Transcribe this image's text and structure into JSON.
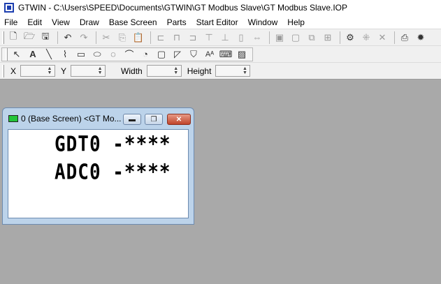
{
  "window": {
    "title": "GTWIN - C:\\Users\\SPEED\\Documents\\GTWIN\\GT Modbus Slave\\GT Modbus Slave.IOP"
  },
  "menu": {
    "items": [
      "File",
      "Edit",
      "View",
      "Draw",
      "Base Screen",
      "Parts",
      "Start Editor",
      "Window",
      "Help"
    ]
  },
  "standard_toolbar": {
    "buttons": [
      "new-icon",
      "open-icon",
      "save-icon",
      "undo-icon",
      "redo-icon",
      "cut-icon",
      "copy-icon",
      "paste-icon",
      "align-left-icon",
      "align-center-icon",
      "align-right-icon",
      "align-top-icon",
      "align-middle-icon",
      "align-bottom-icon",
      "distribute-h-icon",
      "distribute-v-icon",
      "front-icon",
      "back-icon",
      "group-icon",
      "ungroup-icon",
      "lock-icon",
      "properties-icon",
      "grid-icon",
      "snap-icon",
      "transfer-icon",
      "settings-icon"
    ]
  },
  "draw_toolbar": {
    "tools": [
      "select-arrow-icon",
      "text-icon",
      "line-icon",
      "polyline-icon",
      "rectangle-icon",
      "ellipse-icon",
      "arc-icon",
      "sector-icon",
      "pie-icon",
      "rounded-rect-icon",
      "polygon-icon",
      "fill-icon",
      "font-size-icon",
      "mouse-icon",
      "hatch-icon"
    ]
  },
  "coordinates": {
    "x_label": "X",
    "y_label": "Y",
    "width_label": "Width",
    "height_label": "Height",
    "x_value": "",
    "y_value": "",
    "width_value": "",
    "height_value": ""
  },
  "child_window": {
    "title": "0 (Base Screen) <GT Mo...",
    "lines": [
      "GDT0 -****",
      "ADC0 -****"
    ]
  }
}
